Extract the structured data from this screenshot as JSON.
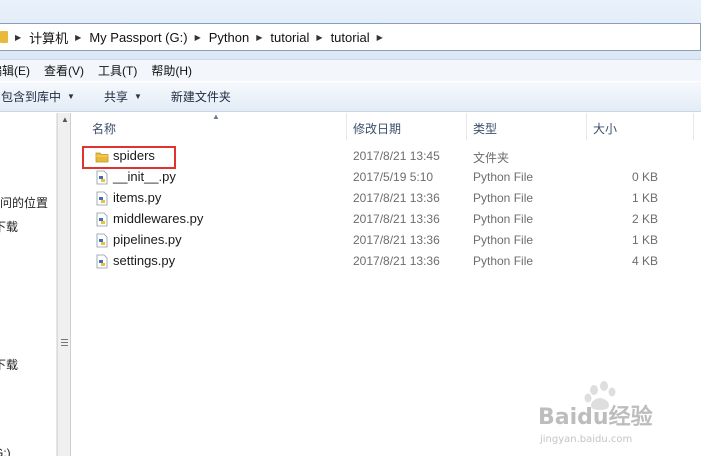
{
  "address_bar": {
    "crumbs": [
      "计算机",
      "My Passport (G:)",
      "Python",
      "tutorial",
      "tutorial"
    ]
  },
  "menu": {
    "items": [
      "编辑(E)",
      "查看(V)",
      "工具(T)",
      "帮助(H)"
    ]
  },
  "toolbar": {
    "include_in_library": "包含到库中",
    "share": "共享",
    "new_folder": "新建文件夹"
  },
  "nav_pane": {
    "items": [
      "访问的位置",
      "下载",
      "下载",
      "(G:)"
    ]
  },
  "columns": {
    "name": "名称",
    "modified": "修改日期",
    "type": "类型",
    "size": "大小"
  },
  "files": [
    {
      "name": "spiders",
      "modified": "2017/8/21 13:45",
      "type": "文件夹",
      "size": "",
      "icon": "folder-icon"
    },
    {
      "name": "__init__.py",
      "modified": "2017/5/19 5:10",
      "type": "Python File",
      "size": "0 KB",
      "icon": "python-file-icon"
    },
    {
      "name": "items.py",
      "modified": "2017/8/21 13:36",
      "type": "Python File",
      "size": "1 KB",
      "icon": "python-file-icon"
    },
    {
      "name": "middlewares.py",
      "modified": "2017/8/21 13:36",
      "type": "Python File",
      "size": "2 KB",
      "icon": "python-file-icon"
    },
    {
      "name": "pipelines.py",
      "modified": "2017/8/21 13:36",
      "type": "Python File",
      "size": "1 KB",
      "icon": "python-file-icon"
    },
    {
      "name": "settings.py",
      "modified": "2017/8/21 13:36",
      "type": "Python File",
      "size": "4 KB",
      "icon": "python-file-icon"
    }
  ],
  "watermark": {
    "brand": "Baidu经验",
    "url": "jingyan.baidu.com"
  },
  "colors": {
    "highlight_border": "#e0322f",
    "folder": "#e8b93a",
    "header_text": "#3c4f6b",
    "detail_text": "#6d6d6d"
  }
}
